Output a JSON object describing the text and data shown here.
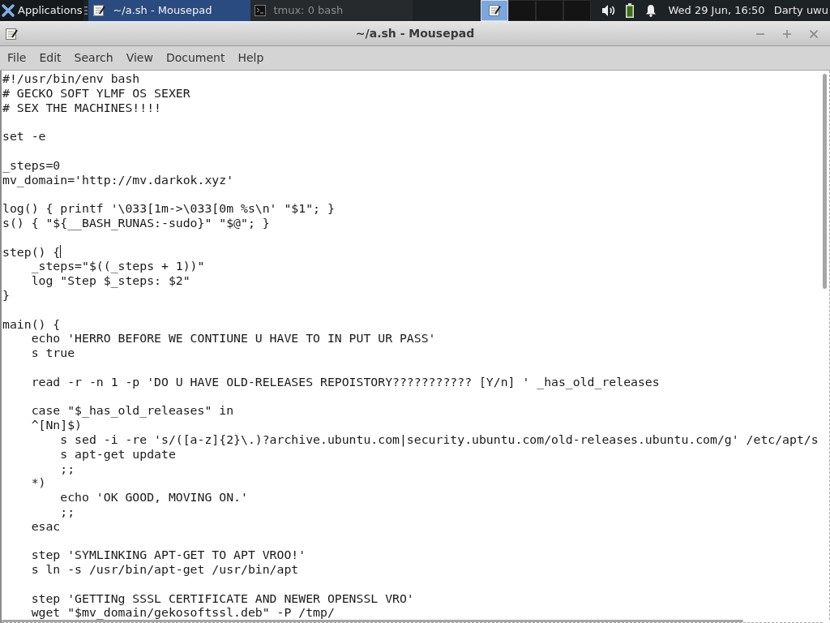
{
  "panel": {
    "applications_menu": {
      "label": "Applications"
    },
    "tasks": [
      {
        "label": "~/a.sh - Mousepad",
        "kind": "editor",
        "selected": true
      },
      {
        "label": "tmux: 0 bash",
        "kind": "terminal",
        "selected": false
      }
    ],
    "workspaces": [
      {
        "selected": true,
        "has_window": true
      },
      {
        "selected": false,
        "has_window": false
      },
      {
        "selected": false,
        "has_window": false
      },
      {
        "selected": false,
        "has_window": false
      }
    ],
    "clock": "Wed 29 Jun, 16:50",
    "user": "Darty uwu"
  },
  "window": {
    "title": "~/a.sh - Mousepad"
  },
  "menu": [
    "File",
    "Edit",
    "Search",
    "View",
    "Document",
    "Help"
  ],
  "editor": {
    "lines": [
      {
        "text": "#!/usr/bin/env bash",
        "cursor": false
      },
      {
        "text": "# GECKO SOFT YLMF OS SEXER",
        "cursor": false
      },
      {
        "text": "# SEX THE MACHINES!!!!",
        "cursor": false
      },
      {
        "cursor": false
      },
      {
        "text": "set -e",
        "cursor": false
      },
      {
        "cursor": false
      },
      {
        "text": "_steps=0",
        "cursor": false
      },
      {
        "text": "mv_domain='http://mv.darkok.xyz'",
        "cursor": false
      },
      {
        "cursor": false
      },
      {
        "text": "log() { printf '\\033[1m->\\033[0m %s\\n' \"$1\"; }",
        "cursor": false
      },
      {
        "text": "s() { \"${__BASH_RUNAS:-sudo}\" \"$@\"; }",
        "cursor": false
      },
      {
        "cursor": false
      },
      {
        "text": "step() {",
        "cursor": true
      },
      {
        "text": "    _steps=\"$((_steps + 1))\"",
        "cursor": false
      },
      {
        "text": "    log \"Step $_steps: $2\"",
        "cursor": false
      },
      {
        "text": "}",
        "cursor": false
      },
      {
        "cursor": false
      },
      {
        "text": "main() {",
        "cursor": false
      },
      {
        "text": "    echo 'HERRO BEFORE WE CONTIUNE U HAVE TO IN PUT UR PASS'",
        "cursor": false
      },
      {
        "text": "    s true",
        "cursor": false
      },
      {
        "cursor": false
      },
      {
        "text": "    read -r -n 1 -p 'DO U HAVE OLD-RELEASES REPOISTORY??????????? [Y/n] ' _has_old_releases",
        "cursor": false
      },
      {
        "cursor": false
      },
      {
        "text": "    case \"$_has_old_releases\" in",
        "cursor": false
      },
      {
        "text": "    ^[Nn]$)",
        "cursor": false
      },
      {
        "text": "        s sed -i -re 's/([a-z]{2}\\.)?archive.ubuntu.com|security.ubuntu.com/old-releases.ubuntu.com/g' /etc/apt/s",
        "cursor": false
      },
      {
        "text": "        s apt-get update",
        "cursor": false
      },
      {
        "text": "        ;;",
        "cursor": false
      },
      {
        "text": "    *)",
        "cursor": false
      },
      {
        "text": "        echo 'OK GOOD, MOVING ON.'",
        "cursor": false
      },
      {
        "text": "        ;;",
        "cursor": false
      },
      {
        "text": "    esac",
        "cursor": false
      },
      {
        "cursor": false
      },
      {
        "text": "    step 'SYMLINKING APT-GET TO APT VROO!'",
        "cursor": false
      },
      {
        "text": "    s ln -s /usr/bin/apt-get /usr/bin/apt",
        "cursor": false
      },
      {
        "cursor": false
      },
      {
        "text": "    step 'GETTINg SSSL CERTIFICATE AND NEWER OPENSSL VRO'",
        "cursor": false
      },
      {
        "text": "    wget \"$mv_domain/gekosoftssl.deb\" -P /tmp/",
        "cursor": false
      }
    ]
  }
}
